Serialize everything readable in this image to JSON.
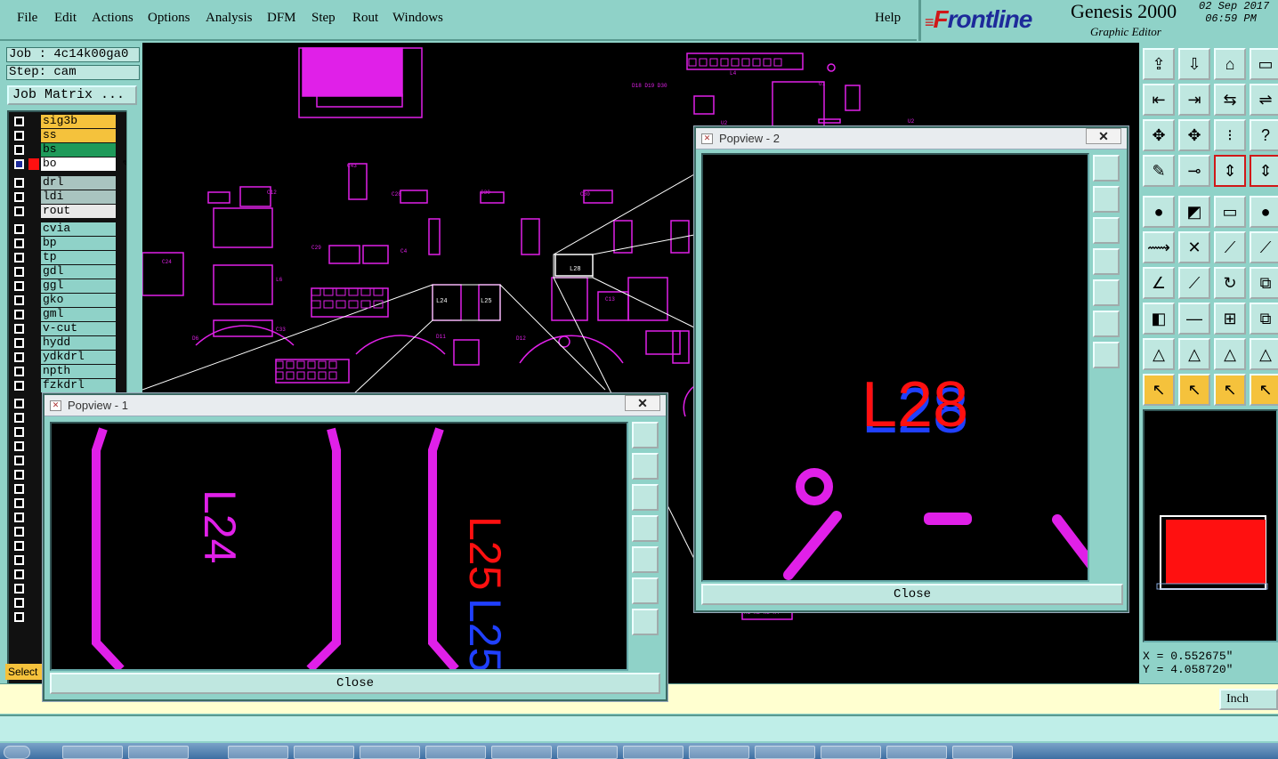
{
  "menu": {
    "items": [
      "File",
      "Edit",
      "Actions",
      "Options",
      "Analysis",
      "DFM",
      "Step",
      "Rout",
      "Windows"
    ],
    "help": "Help"
  },
  "brand": {
    "logo_initial": "F",
    "logo_rest": "rontline",
    "product": "Genesis 2000",
    "subtitle": "Graphic Editor",
    "date": "02 Sep 2017",
    "time": "06:59 PM"
  },
  "job": {
    "job_label": "Job : 4c14k00ga0",
    "step_label": "Step: cam",
    "matrix_button": "Job Matrix ..."
  },
  "layers": [
    {
      "name": "sig3b",
      "color": "#f5c23c",
      "pen": ""
    },
    {
      "name": "ss",
      "color": "#f5c23c",
      "pen": "✎"
    },
    {
      "name": "bs",
      "color": "#1f9a5a",
      "pen": ""
    },
    {
      "name": "bo",
      "color": "#ffffff",
      "pen": "✎⊡",
      "active": true
    },
    {
      "name": "drl",
      "color": "#a9c4c0",
      "pen": ""
    },
    {
      "name": "ldi",
      "color": "#a9c4c0",
      "pen": ""
    },
    {
      "name": "rout",
      "color": "#e8e8e8",
      "pen": ""
    },
    {
      "name": "cvia",
      "color": "#8fd2c8",
      "pen": ""
    },
    {
      "name": "bp",
      "color": "#8fd2c8",
      "pen": ""
    },
    {
      "name": "tp",
      "color": "#8fd2c8",
      "pen": ""
    },
    {
      "name": "gdl",
      "color": "#8fd2c8",
      "pen": "✎"
    },
    {
      "name": "ggl",
      "color": "#8fd2c8",
      "pen": "✎"
    },
    {
      "name": "gko",
      "color": "#8fd2c8",
      "pen": "✎"
    },
    {
      "name": "gml",
      "color": "#8fd2c8",
      "pen": ""
    },
    {
      "name": "v-cut",
      "color": "#8fd2c8",
      "pen": ""
    },
    {
      "name": "hydd",
      "color": "#8fd2c8",
      "pen": ""
    },
    {
      "name": "ydkdrl",
      "color": "#8fd2c8",
      "pen": ""
    },
    {
      "name": "npth",
      "color": "#8fd2c8",
      "pen": ""
    },
    {
      "name": "fzkdrl",
      "color": "#8fd2c8",
      "pen": ""
    }
  ],
  "select_label": "Select",
  "popview1": {
    "title": "Popview - 1",
    "close": "Close",
    "labels": [
      "L24",
      "L25",
      "L25"
    ]
  },
  "popview2": {
    "title": "Popview - 2",
    "close": "Close",
    "labels": [
      "L28"
    ]
  },
  "coords": {
    "x": "X = 0.552675\"",
    "y": "Y = 4.058720\""
  },
  "units": "Inch",
  "colors": {
    "panel": "#8fd2c8",
    "magenta": "#e020e8",
    "red": "#ff1010",
    "blue": "#2040ff",
    "yellow": "#f5c23c"
  }
}
